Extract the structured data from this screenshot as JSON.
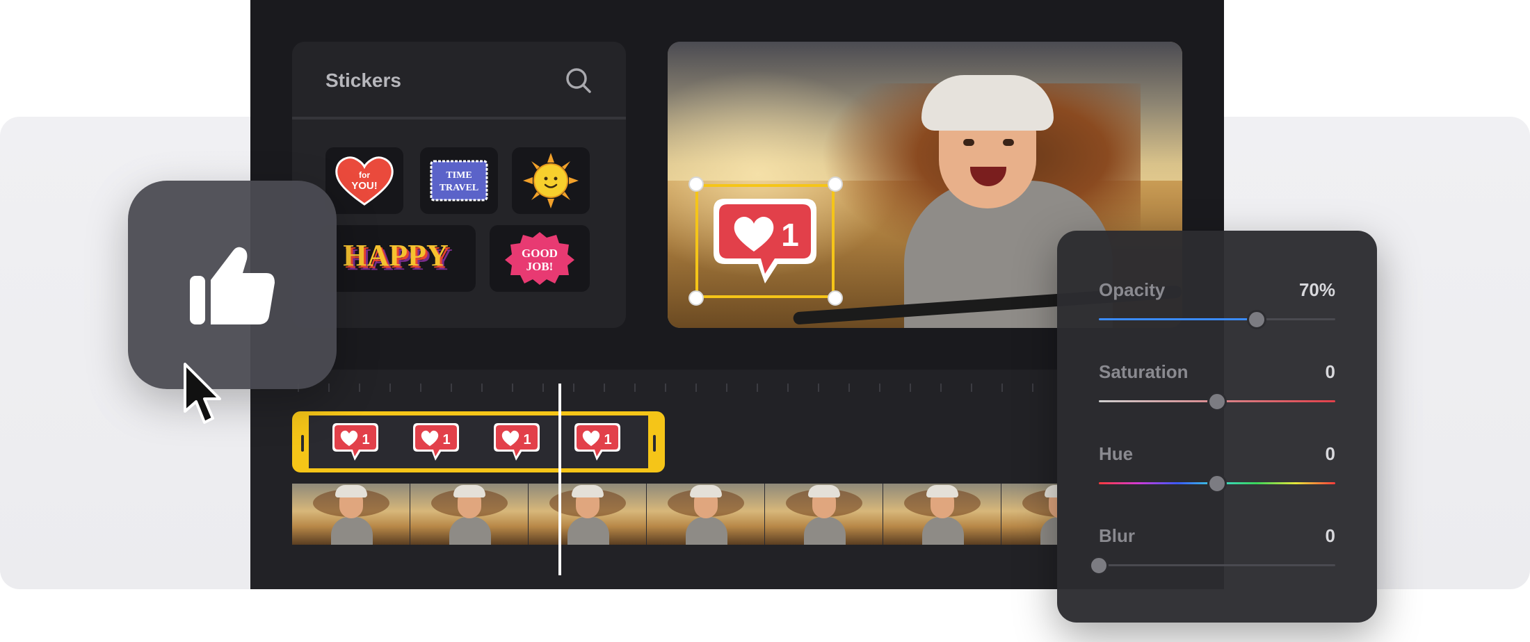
{
  "stickers_panel": {
    "title": "Stickers",
    "search_icon": "search-icon",
    "items": [
      {
        "name": "heart-for-you-sticker",
        "text_line1": "for",
        "text_line2": "YOU!"
      },
      {
        "name": "time-travel-sticker",
        "text_line1": "TIME",
        "text_line2": "TRAVEL"
      },
      {
        "name": "sun-smile-sticker"
      },
      {
        "name": "happy-sticker",
        "text": "HAPPY"
      },
      {
        "name": "good-job-sticker",
        "text_line1": "GOOD",
        "text_line2": "JOB!"
      }
    ]
  },
  "preview": {
    "selected_sticker": {
      "name": "like-heart-sticker",
      "count": "1"
    }
  },
  "timeline": {
    "sticker_clip": {
      "count": "1",
      "instances": 4
    },
    "video_frames": 7,
    "playhead_icon": "playhead"
  },
  "properties": {
    "opacity": {
      "label": "Opacity",
      "value": "70%",
      "level": 0.667,
      "color": "#3b8cff"
    },
    "saturation": {
      "label": "Saturation",
      "value": "0",
      "level": 0.5
    },
    "hue": {
      "label": "Hue",
      "value": "0",
      "level": 0.5
    },
    "blur": {
      "label": "Blur",
      "value": "0",
      "level": 0.0
    }
  },
  "overlay": {
    "like_icon": "thumbs-up-icon",
    "cursor_icon": "mouse-pointer-icon"
  },
  "colors": {
    "accent_yellow": "#f5c518",
    "sticker_red": "#e2404a",
    "panel_dark": "#1a1a1e"
  }
}
